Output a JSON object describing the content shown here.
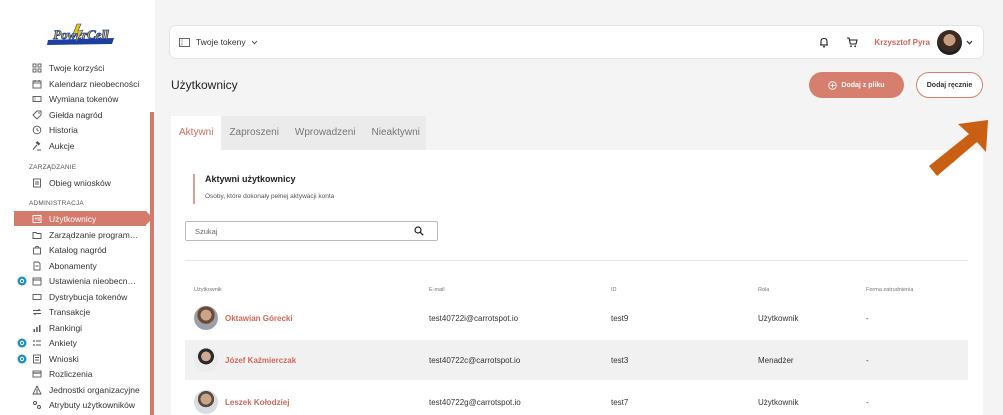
{
  "brand": {
    "logo_text": "PowerCell"
  },
  "sidebar": {
    "items_top": [
      {
        "label": "Twoje korzyści",
        "icon": "grid-icon"
      },
      {
        "label": "Kalendarz nieobecności",
        "icon": "calendar-icon"
      },
      {
        "label": "Wymiana tokenów",
        "icon": "ticket-icon"
      },
      {
        "label": "Giełda nagród",
        "icon": "tag-icon"
      },
      {
        "label": "Historia",
        "icon": "history-icon"
      },
      {
        "label": "Aukcje",
        "icon": "gavel-icon"
      }
    ],
    "section_management": "ZARZĄDZANIE",
    "items_management": [
      {
        "label": "Obieg wniosków",
        "icon": "document-flow-icon"
      }
    ],
    "section_admin": "ADMINISTRACJA",
    "items_admin": [
      {
        "label": "Użytkownicy",
        "icon": "users-icon"
      },
      {
        "label": "Zarządzanie program…",
        "icon": "folder-icon"
      },
      {
        "label": "Katalog nagród",
        "icon": "bag-icon"
      },
      {
        "label": "Abonamenty",
        "icon": "file-icon"
      },
      {
        "label": "Ustawienia nieobecn…",
        "icon": "calendar-settings-icon"
      },
      {
        "label": "Dystrybucja tokenów",
        "icon": "ticket-icon"
      },
      {
        "label": "Transakcje",
        "icon": "transfer-icon"
      },
      {
        "label": "Rankingi",
        "icon": "bar-chart-icon"
      },
      {
        "label": "Ankiety",
        "icon": "list-icon"
      },
      {
        "label": "Wnioski",
        "icon": "form-icon"
      },
      {
        "label": "Rozliczenia",
        "icon": "card-icon"
      },
      {
        "label": "Jednostki organizacyjne",
        "icon": "hierarchy-icon"
      },
      {
        "label": "Atrybuty użytkowników",
        "icon": "attributes-icon"
      }
    ]
  },
  "topbar": {
    "tokens_label": "Twoje tokeny",
    "user_name": "Krzysztof Pyra"
  },
  "page": {
    "title": "Użytkownicy",
    "btn_file": "Dodaj z pliku",
    "btn_manual": "Dodaj ręcznie"
  },
  "tabs": [
    "Aktywni",
    "Zaproszeni",
    "Wprowadzeni",
    "Nieaktywni"
  ],
  "section": {
    "title": "Aktywni użytkownicy",
    "subtitle": "Osoby, które dokonały pełnej aktywacji konta"
  },
  "search": {
    "placeholder": "Szukaj"
  },
  "table": {
    "headers": [
      "Użytkownik",
      "E-mail",
      "ID",
      "Rola",
      "Forma zatrudnienia"
    ],
    "rows": [
      {
        "name": "Oktawian Górecki",
        "email": "test40722i@carrotspot.io",
        "id": "test9",
        "role": "Użytkownik",
        "employment": "-"
      },
      {
        "name": "Józef Kaźmierczak",
        "email": "test40722c@carrotspot.io",
        "id": "test3",
        "role": "Menadżer",
        "employment": "-"
      },
      {
        "name": "Leszek Kołodziej",
        "email": "test40722g@carrotspot.io",
        "id": "test7",
        "role": "Użytkownik",
        "employment": "-"
      }
    ]
  },
  "colors": {
    "accent": "#d0675a",
    "accent_button": "#d77f6f",
    "arrow": "#c95f12"
  }
}
